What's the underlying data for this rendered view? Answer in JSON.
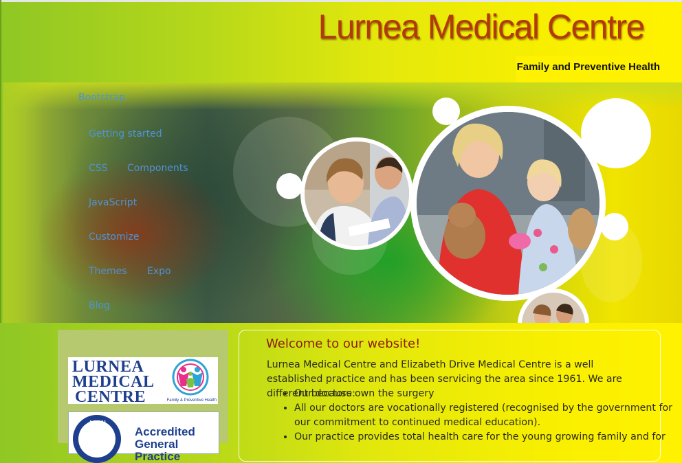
{
  "header": {
    "site_title": "Lurnea Medical Centre",
    "tagline": "Family and Preventive Health"
  },
  "nav": {
    "brand": "Bootstrap",
    "links": [
      "Getting started",
      "CSS",
      "Components",
      "JavaScript",
      "Customize",
      "Themes",
      "Expo",
      "Blog"
    ]
  },
  "sidebar": {
    "logo_line1": "LURNEA",
    "logo_line2": "MEDICAL",
    "logo_line3": "CENTRE",
    "logo_caption": "Family & Preventive Health",
    "accred_seal_text": "AGPAL",
    "accred_line1": "Accredited",
    "accred_line2": "General Practice"
  },
  "content": {
    "welcome_heading": "Welcome to our website!",
    "intro": "Lurnea Medical Centre and Elizabeth Drive Medical Centre is a well established practice and has been servicing the area since 1961. We are different because:",
    "reasons": [
      "Our doctors own the surgery",
      "All our doctors are vocationally registered (recognised by the government for our commitment to continued medical education).",
      "Our practice provides total health care for the young growing family and for"
    ]
  },
  "colors": {
    "title": "#b23a0a",
    "nav_link": "#4f93d4",
    "welcome": "#8a1f10",
    "logo_blue": "#1e3f8e"
  }
}
